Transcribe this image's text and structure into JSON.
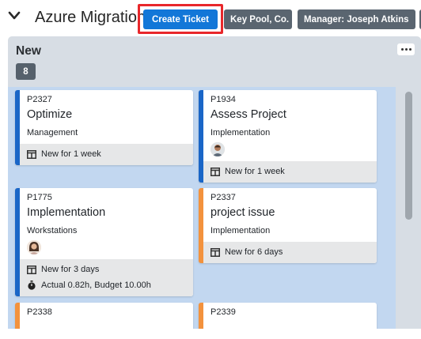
{
  "header": {
    "title": "Azure Migration",
    "create_ticket": "Create Ticket",
    "chip_company": "Key Pool, Co.",
    "chip_manager": "Manager: Joseph Atkins"
  },
  "column": {
    "title": "New",
    "count": "8"
  },
  "cards": [
    {
      "id": "P2327",
      "title": "Optimize",
      "category": "Management",
      "age": "New for 1 week",
      "color": "#1a66c7"
    },
    {
      "id": "P1934",
      "title": "Assess Project",
      "category": "Implementation",
      "age": "New for 1 week",
      "color": "#1a66c7"
    },
    {
      "id": "P1775",
      "title": "Implementation",
      "category": "Workstations",
      "age": "New for 3 days",
      "budget": "Actual 0.82h, Budget 10.00h",
      "color": "#1a66c7"
    },
    {
      "id": "P2337",
      "title": "project issue",
      "category": "Implementation",
      "age": "New for 6 days",
      "color": "#f3923d"
    },
    {
      "id": "P2338",
      "color": "#f3923d"
    },
    {
      "id": "P2339",
      "color": "#f3923d"
    }
  ],
  "colors": {
    "primary": "#1277d8",
    "highlight": "#e8272b",
    "chip": "#5a6570",
    "lane": "#c2d7f0"
  }
}
